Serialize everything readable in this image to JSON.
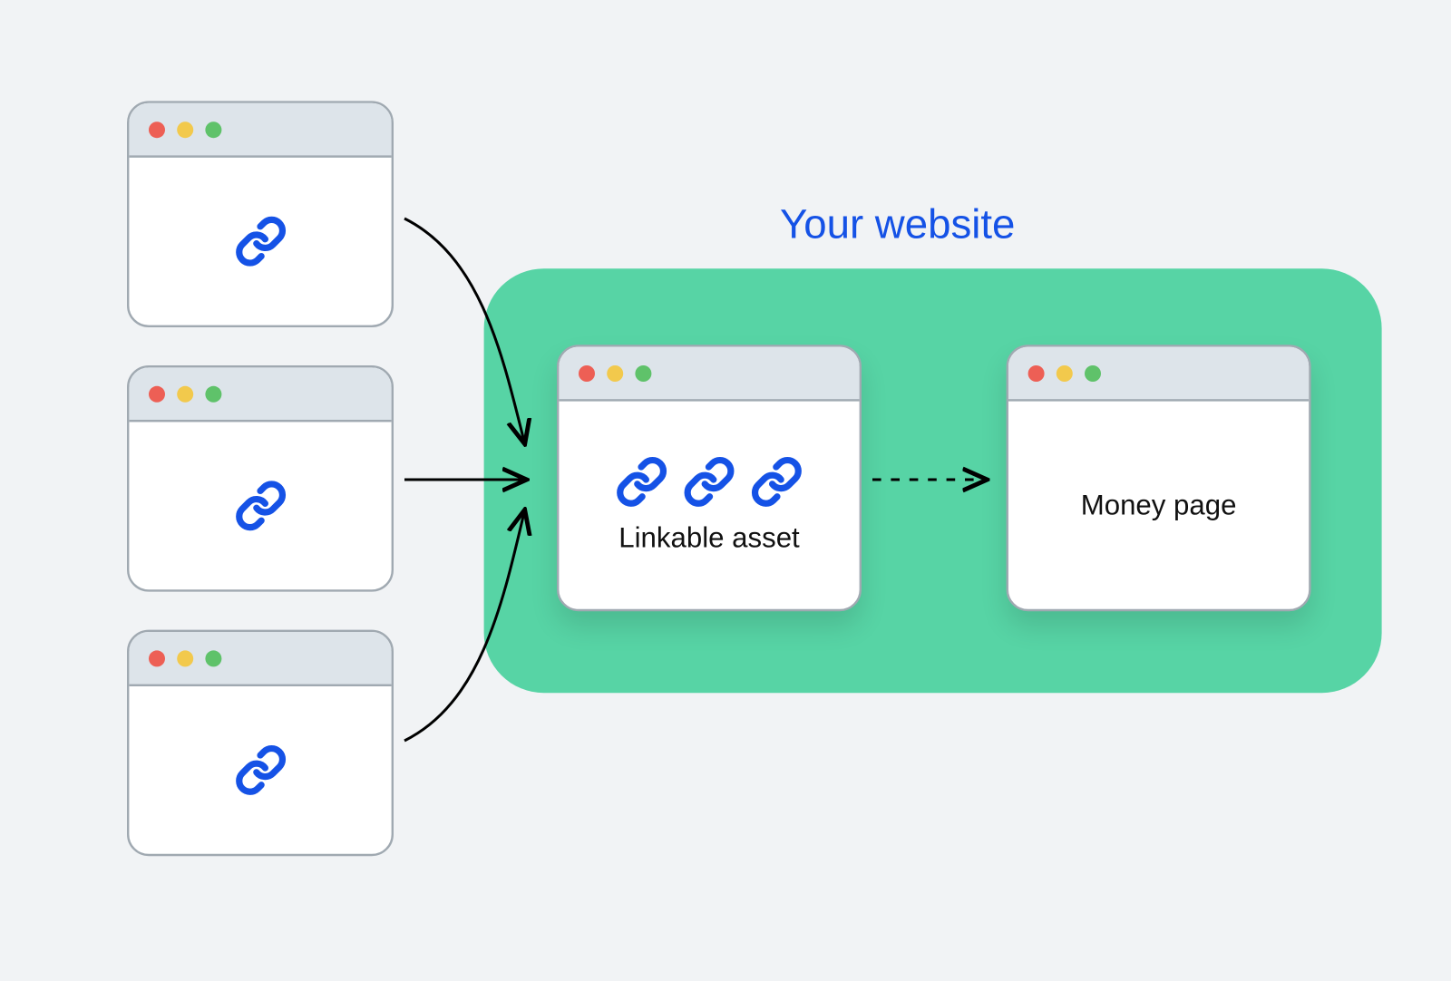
{
  "title": "Your website",
  "linkable_asset_label": "Linkable asset",
  "money_page_label": "Money page",
  "colors": {
    "background": "#f1f3f5",
    "website_box": "#57d4a5",
    "title_text": "#1552e6",
    "link_icon": "#1552e6",
    "window_border": "#a0a9b1",
    "titlebar_bg": "#dde4ea",
    "dot_red": "#ed5f55",
    "dot_yellow": "#f2c94c",
    "dot_green": "#5fc26a"
  },
  "diagram": {
    "external_pages": 3,
    "external_links_each": 1,
    "linkable_asset_links": 3,
    "arrows_external_to_asset": "solid",
    "arrow_asset_to_money": "dashed"
  }
}
